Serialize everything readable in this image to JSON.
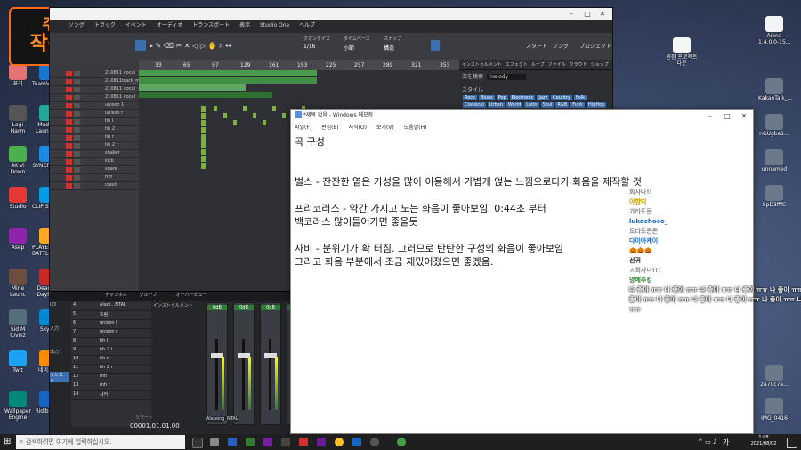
{
  "logo": {
    "line1": "주석",
    "line2": "작곡법"
  },
  "desktop_left_icons": [
    "프리",
    "TeamViewer",
    "Logi\nHarm",
    "Mudfish\nLauncher",
    "4K Vi\nDown",
    "SYNCROOM",
    "Studio",
    "CLIP STUDIO",
    "Asep",
    "PLAYERUN...\nBATTLEGR...",
    "Mine\nLaunc",
    "Dead by\nDaylight",
    "Sid M\nCiviliz",
    "Skype",
    "Twit",
    "네이트온",
    "Wallpaper\nEngine",
    "Ridibooks"
  ],
  "desktop_right_icons": [
    "Aiona\n1.4.0.0-15...",
    "원점 프로젝트\n다운",
    "KakaoTalk_...",
    "nGUgbe1...",
    "unnamed",
    "8pD3fffC",
    "2a70c7a...",
    "IMG_0416"
  ],
  "studio": {
    "title": "",
    "menu": [
      "ソング",
      "トラック",
      "イベント",
      "オーディオ",
      "トランスポート",
      "表示",
      "Studio One",
      "ヘルプ"
    ],
    "toolbar": {
      "quantize": "クオンタイズ",
      "quantize_val": "1/16",
      "timebase": "タイムベース",
      "timebase_val": "小節",
      "snap": "スナップ",
      "snap_val": "構造",
      "start": "スタート",
      "song": "ソング",
      "project": "プロジェクト"
    },
    "ruler": [
      "33",
      "65",
      "97",
      "129",
      "161",
      "193",
      "225",
      "257",
      "289",
      "321",
      "353"
    ],
    "tracks": [
      "210811 vocal",
      "210811track_m...",
      "210811 vocal",
      "210811 vocal",
      "unison 1",
      "unison r",
      "hh l",
      "hh 2 l",
      "hh r",
      "hh 2 r",
      "shaker",
      "kick",
      "snare",
      "rim",
      "crash"
    ],
    "browser": {
      "tabs": [
        "インストゥルメント",
        "エフェクト",
        "ループ",
        "ファイル",
        "クラウド",
        "ショップ",
        "プール"
      ],
      "search_label": "次を検索",
      "search_value": "melody",
      "style_label": "スタイル",
      "styles": [
        "Rock",
        "Blues",
        "Pop",
        "Electronic",
        "Jazz",
        "Country",
        "Folk",
        "Classical",
        "Urban",
        "World",
        "Latin",
        "Soul",
        "R&B",
        "Funk",
        "HipHop",
        "Metal",
        "House",
        "Electro"
      ]
    },
    "console": {
      "tabs": [
        "チャンネル",
        "グループ"
      ],
      "header": "オーバービュー",
      "inputs": "インストゥルメント",
      "channels": [
        "Aladi...NTAL",
        "트림",
        "unison l",
        "unison r",
        "hh l",
        "hh 2 l",
        "hh r",
        "hh 2 r",
        "mh l",
        "mh r",
        "샤커"
      ],
      "numbers": [
        "4",
        "5",
        "6",
        "7",
        "8",
        "9",
        "10",
        "11",
        "12",
        "13",
        "14",
        "15"
      ],
      "side_labels": [
        "I/O",
        "入力",
        "出力",
        "インスト..."
      ],
      "fader_label": "Alabong_NTAL",
      "db": "0dB",
      "time": "00001.01.01.00",
      "remote": "リモート"
    }
  },
  "notepad": {
    "title": "*제목 없음 - Windows 메모장",
    "menu": [
      "파일(F)",
      "편집(E)",
      "서식(O)",
      "보기(V)",
      "도움말(H)"
    ],
    "lines": [
      "곡 구성",
      "",
      "",
      "벌스 - 잔잔한 옅은 가성을 많이 이용해서 가볍게 얹는 느낌으로다가 화음을 제작할 것",
      "",
      "프리코러스 - 약간 가지고 노는 화음이 좋아보임  0:44초 부터",
      "백코러스 많이들어가면 좋을듯",
      "",
      "사비 - 분위기가 확 터짐. 그러므로 탄탄한 구성의 화음이 좋아보임",
      "그리고 화음 부분에서 조금 재밌어졌으면 좋겠음."
    ]
  },
  "chat": [
    {
      "text": "회사나!!",
      "color": "#888888"
    },
    {
      "text": "야향띠",
      "color": "#c8a000"
    },
    {
      "text": "가라도돈",
      "color": "#888888"
    },
    {
      "text": "lukachoco_",
      "color": "#1565c0"
    },
    {
      "text": "도라도돈돈",
      "color": "#888888"
    },
    {
      "text": "다이아케이",
      "color": "#1565c0"
    },
    {
      "text": "🎃🎃🎃",
      "color": "#555555"
    },
    {
      "text": "선귀",
      "color": "#222222"
    },
    {
      "text": "ㅊ회사나!!!",
      "color": "#888888"
    },
    {
      "text": "양메추킹",
      "color": "#2e7d32"
    },
    {
      "text": "나 좋이 ㅠㅠ 나 좋이 ㅠㅠ 나 좋이 ㅠㅠ 나 좋이 ㅠㅠ 나 좋이 ㅠㅠ 나",
      "color": "#ffffff"
    },
    {
      "text": "좋이 ㅠㅠ 나 좋이 ㅠㅠ 나 좋이 ㅠㅠ 나 좋이 ㅠㅠ 나 좋이 ㅠㅠ 나 좋이",
      "color": "#ffffff"
    },
    {
      "text": "ㅠㅠ",
      "color": "#ffffff"
    }
  ],
  "taskbar": {
    "search_placeholder": "검색하려면 여기에 입력하십시오.",
    "time": "1:08",
    "date": "2021/08/02",
    "ime": "가"
  },
  "colors": {
    "accent": "#3b6fb0",
    "logo": "#ff6a1a"
  }
}
